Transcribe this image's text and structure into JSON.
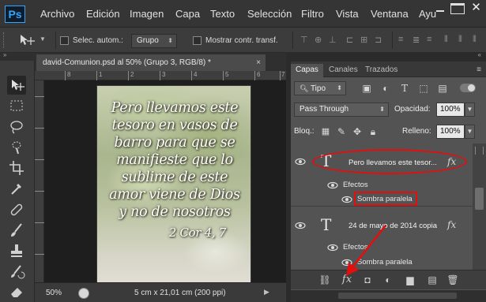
{
  "app": {
    "logo": "Ps",
    "menu": [
      "Archivo",
      "Edición",
      "Imagen",
      "Capa",
      "Texto",
      "Selección",
      "Filtro",
      "Vista",
      "Ventana",
      "Ayu"
    ]
  },
  "options_bar": {
    "auto_select_label": "Selec. autom.:",
    "auto_select_value": "Grupo",
    "show_transform_label": "Mostrar contr. transf."
  },
  "document": {
    "tab_title": "david-Comunion.psd al 50% (Grupo 3, RGB/8) *",
    "tab_close": "×",
    "ruler_labels": [
      "8",
      "1",
      "2",
      "3",
      "4",
      "5",
      "6",
      "7"
    ],
    "verse_lines": [
      "Pero llevamos este",
      "tesoro en vasos de",
      "barro para que se",
      "manifieste que lo",
      "sublime de este",
      "amor viene de Dios",
      "y no de nosotros"
    ],
    "verse_reference": "2 Cor 4, 7",
    "zoom": "50%",
    "size_info": "5 cm x 21,01 cm (200 ppi)"
  },
  "layers_panel": {
    "tabs": [
      "Capas",
      "Canales",
      "Trazados"
    ],
    "filter_kind": "Tipo",
    "blend_mode": "Pass Through",
    "opacity_label": "Opacidad:",
    "opacity_value": "100%",
    "lock_label": "Bloq.:",
    "fill_label": "Relleno:",
    "fill_value": "100%",
    "layers": [
      {
        "name": "Pero llevamos este tesor...",
        "effects_label": "Efectos",
        "effect": "Sombra paralela",
        "fx": "fx"
      },
      {
        "name": "24 de mayo de 2014 copia",
        "effects_label": "Efectos",
        "effect": "Sombra paralela",
        "fx": "fx"
      }
    ],
    "footer_fx": "fx"
  },
  "colors": {
    "annotation_red": "#e30f0f",
    "ps_blue": "#3aa3f5"
  }
}
